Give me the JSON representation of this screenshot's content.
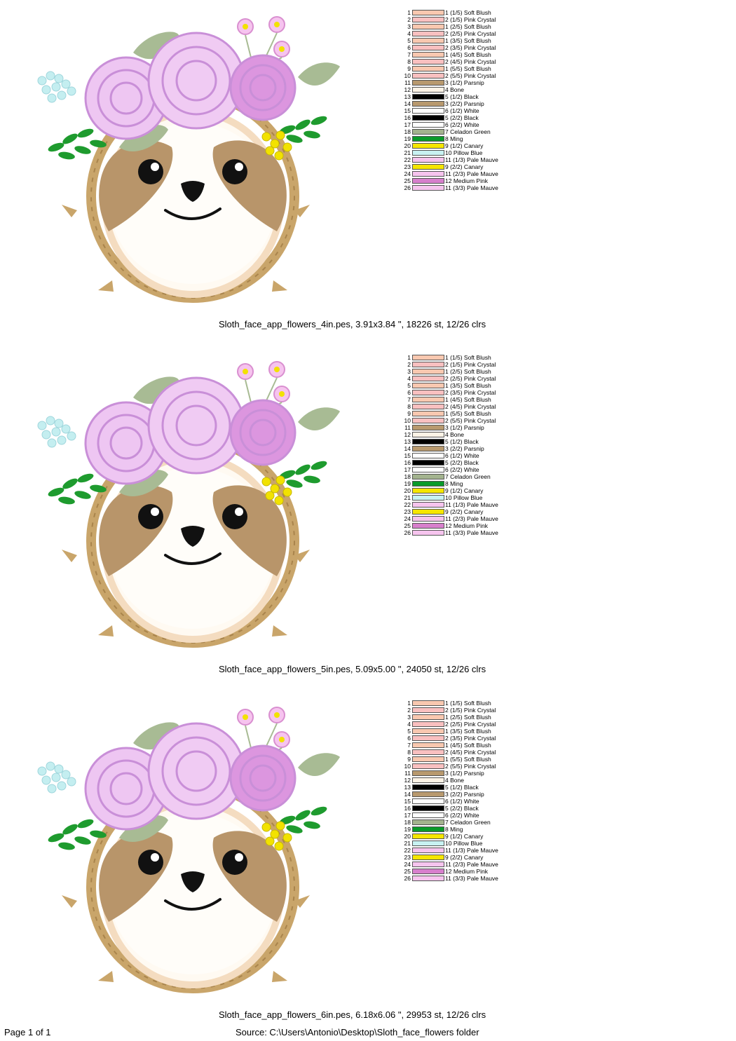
{
  "colors": [
    {
      "num": "1",
      "label": "1 (1/5) Soft Blush",
      "hex": "#f9c8b0"
    },
    {
      "num": "2",
      "label": "2 (1/5) Pink Crystal",
      "hex": "#f9c0c0"
    },
    {
      "num": "3",
      "label": "1 (2/5) Soft Blush",
      "hex": "#f9c8b0"
    },
    {
      "num": "4",
      "label": "2 (2/5) Pink Crystal",
      "hex": "#f9c0c0"
    },
    {
      "num": "5",
      "label": "1 (3/5) Soft Blush",
      "hex": "#f9c8b0"
    },
    {
      "num": "6",
      "label": "2 (3/5) Pink Crystal",
      "hex": "#f9c0c0"
    },
    {
      "num": "7",
      "label": "1 (4/5) Soft Blush",
      "hex": "#f9c8b0"
    },
    {
      "num": "8",
      "label": "2 (4/5) Pink Crystal",
      "hex": "#f9c0c0"
    },
    {
      "num": "9",
      "label": "1 (5/5) Soft Blush",
      "hex": "#f9c8b0"
    },
    {
      "num": "10",
      "label": "2 (5/5) Pink Crystal",
      "hex": "#f9c0c0"
    },
    {
      "num": "11",
      "label": "3 (1/2) Parsnip",
      "hex": "#b8996e"
    },
    {
      "num": "12",
      "label": "4 Bone",
      "hex": "#fdf3e6"
    },
    {
      "num": "13",
      "label": "5 (1/2) Black",
      "hex": "#000000"
    },
    {
      "num": "14",
      "label": "3 (2/2) Parsnip",
      "hex": "#b8996e"
    },
    {
      "num": "15",
      "label": "6 (1/2) White",
      "hex": "#ffffff"
    },
    {
      "num": "16",
      "label": "5 (2/2) Black",
      "hex": "#000000"
    },
    {
      "num": "17",
      "label": "6 (2/2) White",
      "hex": "#ffffff"
    },
    {
      "num": "18",
      "label": "7 Celadon Green",
      "hex": "#a3b38e"
    },
    {
      "num": "19",
      "label": "8 Ming",
      "hex": "#0a9a2a"
    },
    {
      "num": "20",
      "label": "9 (1/2) Canary",
      "hex": "#f5e600"
    },
    {
      "num": "21",
      "label": "10 Pillow Blue",
      "hex": "#c8f2f2"
    },
    {
      "num": "22",
      "label": "11 (1/3) Pale Mauve",
      "hex": "#f6c4ee"
    },
    {
      "num": "23",
      "label": "9 (2/2) Canary",
      "hex": "#f5e600"
    },
    {
      "num": "24",
      "label": "11 (2/3) Pale Mauve",
      "hex": "#f6c4ee"
    },
    {
      "num": "25",
      "label": "12 Medium Pink",
      "hex": "#d77fcc"
    },
    {
      "num": "26",
      "label": "11 (3/3) Pale Mauve",
      "hex": "#f6c4ee"
    }
  ],
  "designs": [
    {
      "caption": "Sloth_face_app_flowers_4in.pes, 3.91x3.84 \", 18226 st, 12/26 clrs"
    },
    {
      "caption": "Sloth_face_app_flowers_5in.pes, 5.09x5.00 \", 24050 st, 12/26 clrs"
    },
    {
      "caption": "Sloth_face_app_flowers_6in.pes, 6.18x6.06 \", 29953 st, 12/26 clrs"
    }
  ],
  "footer": {
    "page": "Page 1 of 1",
    "source": "Source: C:\\Users\\Antonio\\Desktop\\Sloth_face_flowers folder"
  }
}
